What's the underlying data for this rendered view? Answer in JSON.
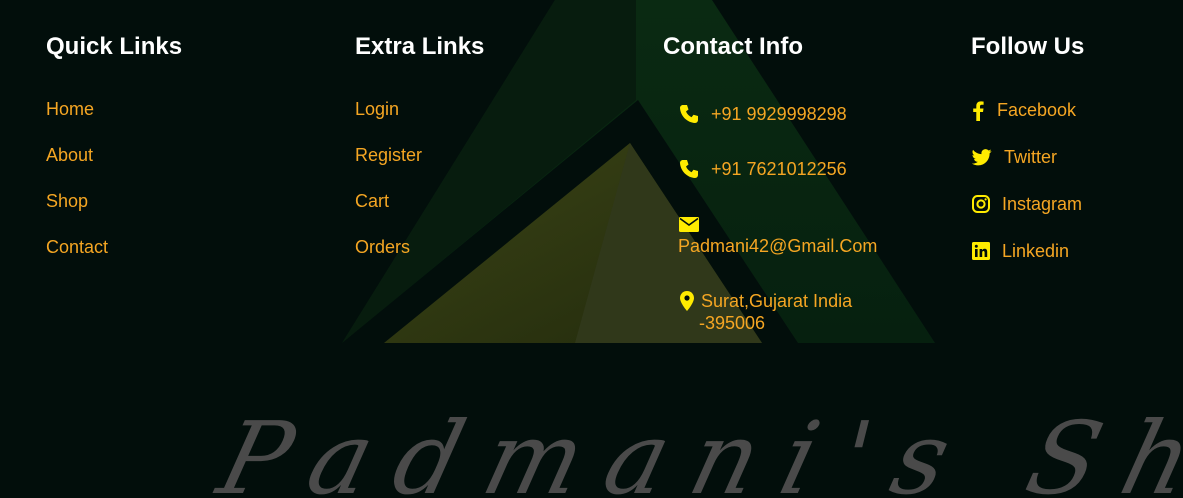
{
  "quick_links": {
    "title": "Quick Links",
    "items": [
      "Home",
      "About",
      "Shop",
      "Contact"
    ]
  },
  "extra_links": {
    "title": "Extra Links",
    "items": [
      "Login",
      "Register",
      "Cart",
      "Orders"
    ]
  },
  "contact_info": {
    "title": "Contact Info",
    "phone_1": "+91 9929998298",
    "phone_2": "+91 7621012256",
    "email": "Padmani42@Gmail.Com",
    "address_line_1": "Surat,Gujarat India",
    "address_line_2": "-395006"
  },
  "follow_us": {
    "title": "Follow Us",
    "items": [
      {
        "label": "Facebook",
        "icon": "facebook-icon"
      },
      {
        "label": "Twitter",
        "icon": "twitter-icon"
      },
      {
        "label": "Instagram",
        "icon": "instagram-icon"
      },
      {
        "label": "Linkedin",
        "icon": "linkedin-icon"
      }
    ]
  },
  "brand": {
    "watermark": "Padmani's Shop"
  },
  "colors": {
    "background": "#020e0b",
    "heading": "#ffffff",
    "link": "#f5a623",
    "icon": "#ffeb00",
    "watermark": "#4a4a4a"
  }
}
